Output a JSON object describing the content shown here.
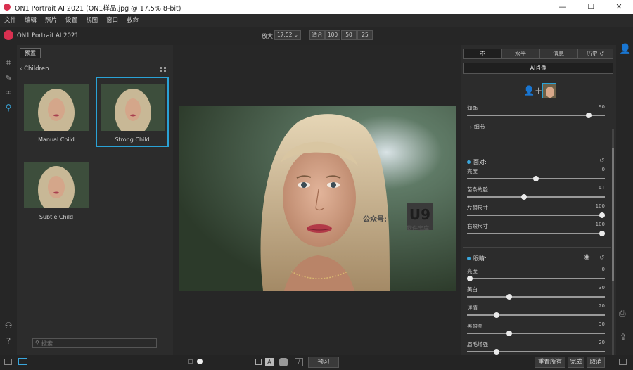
{
  "window": {
    "title": "ON1 Portrait AI 2021 (ON1样品.jpg @ 17.5% 8-bit)",
    "min": "—",
    "max": "☐",
    "close": "✕"
  },
  "menu": [
    "文件",
    "编辑",
    "照片",
    "设置",
    "视图",
    "窗口",
    "救命"
  ],
  "app": {
    "name": "ON1 Portrait AI 2021"
  },
  "zoom": {
    "label": "放大",
    "value": "17.52",
    "buttons": [
      "适合",
      "100",
      "50",
      "25"
    ]
  },
  "left_panel": {
    "tab": "预置",
    "breadcrumb": "Children",
    "presets": [
      {
        "label": "Manual Child",
        "selected": false
      },
      {
        "label": "Strong Child",
        "selected": true
      },
      {
        "label": "Subtle Child",
        "selected": false
      }
    ],
    "search_placeholder": "搜索"
  },
  "right_panel": {
    "tabs": [
      "不",
      "水平",
      "信息",
      "历史"
    ],
    "active_tab": 0,
    "ai_button": "AI肖像",
    "smooth": {
      "label": "润饰",
      "value": "90",
      "level": 0.9
    },
    "detail_label": "细节",
    "face_section": {
      "title": "面对:",
      "sliders": [
        {
          "label": "亮度",
          "value": "0",
          "level": 0.5
        },
        {
          "label": "苗条的脸",
          "value": "41",
          "level": 0.41
        },
        {
          "label": "左眼尺寸",
          "value": "100",
          "level": 1.0
        },
        {
          "label": "右眼尺寸",
          "value": "100",
          "level": 1.0
        }
      ]
    },
    "eyes_section": {
      "title": "眼睛:",
      "sliders": [
        {
          "label": "亮度",
          "value": "0",
          "level": 0.0
        },
        {
          "label": "美白",
          "value": "30",
          "level": 0.3
        },
        {
          "label": "详情",
          "value": "20",
          "level": 0.2
        },
        {
          "label": "黑眼圈",
          "value": "30",
          "level": 0.3
        },
        {
          "label": "眉毛增强",
          "value": "20",
          "level": 0.2
        }
      ]
    }
  },
  "bottom": {
    "preview": "预习",
    "reset_all": "重置所有",
    "done": "完成",
    "cancel": "取消"
  },
  "watermark": {
    "text1": "公众号:",
    "logo": "U9",
    "text2": "软件宝库"
  },
  "colors": {
    "accent": "#2aa2d6",
    "brand": "#d93050"
  }
}
